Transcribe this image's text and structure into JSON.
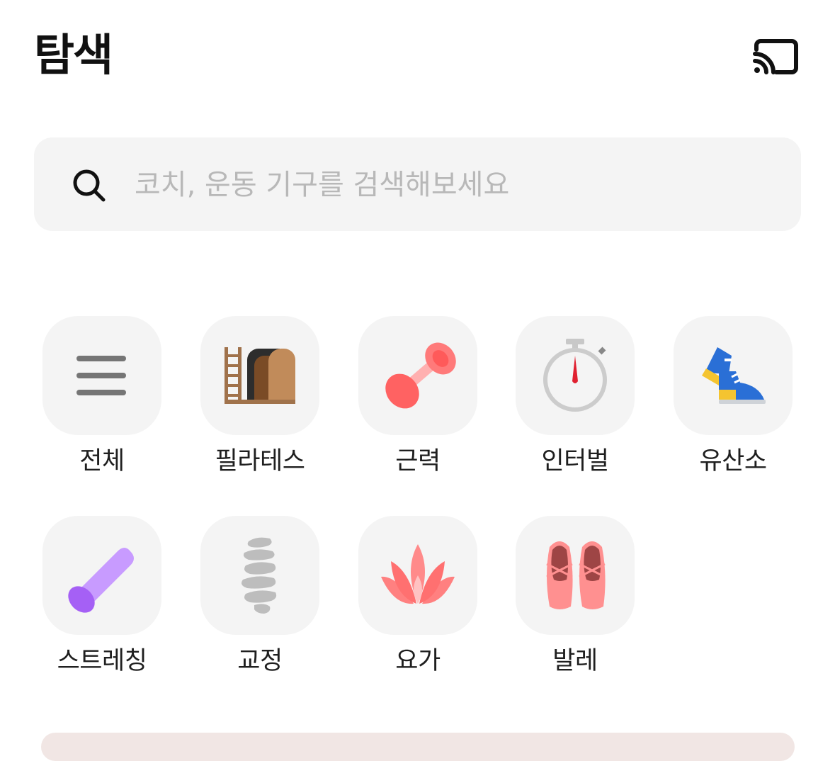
{
  "header": {
    "title": "탐색",
    "cast_icon": "cast-icon"
  },
  "search": {
    "placeholder": "코치, 운동 기구를 검색해보세요",
    "value": "",
    "icon": "search-icon"
  },
  "categories": [
    {
      "label": "전체",
      "icon": "menu-icon"
    },
    {
      "label": "필라테스",
      "icon": "pilates-reformer-icon"
    },
    {
      "label": "근력",
      "icon": "dumbbell-icon"
    },
    {
      "label": "인터벌",
      "icon": "stopwatch-icon"
    },
    {
      "label": "유산소",
      "icon": "sneakers-icon"
    },
    {
      "label": "스트레칭",
      "icon": "foam-roller-icon"
    },
    {
      "label": "교정",
      "icon": "spine-icon"
    },
    {
      "label": "요가",
      "icon": "lotus-icon"
    },
    {
      "label": "발레",
      "icon": "ballet-shoes-icon"
    }
  ],
  "colors": {
    "tile_background": "#f4f4f4",
    "search_background": "#f4f4f4",
    "placeholder": "#b8b8b8"
  }
}
